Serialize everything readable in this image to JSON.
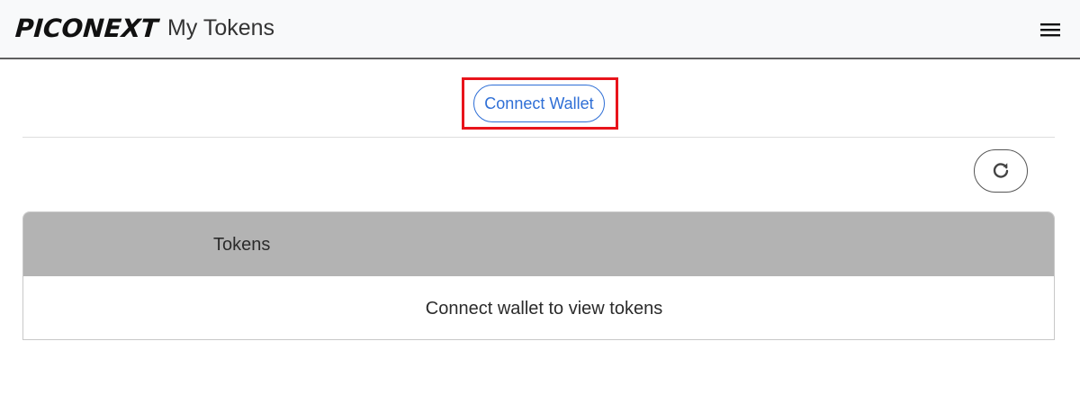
{
  "header": {
    "logo_text": "PICONEXT",
    "page_title": "My Tokens",
    "menu_icon": "hamburger-menu-icon"
  },
  "wallet": {
    "connect_label": "Connect Wallet",
    "highlight_color": "#e8141b",
    "accent_color": "#2f6fd6"
  },
  "toolbar": {
    "refresh_icon": "refresh-icon"
  },
  "tokens_table": {
    "columns": [
      "Tokens"
    ],
    "empty_message": "Connect wallet to view tokens",
    "header_color": "#b3b3b3"
  }
}
